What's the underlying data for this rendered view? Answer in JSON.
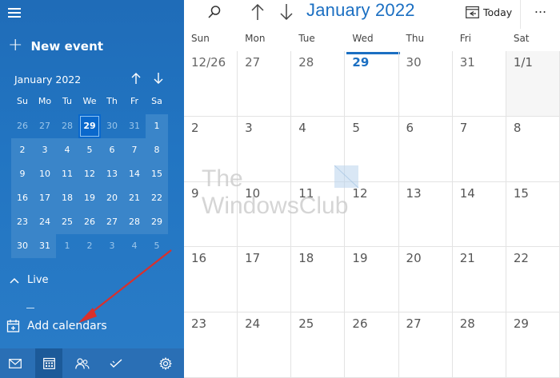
{
  "sidebar": {
    "new_event_label": "New event",
    "mini_calendar": {
      "title": "January 2022",
      "weekdays": [
        "Su",
        "Mo",
        "Tu",
        "We",
        "Th",
        "Fr",
        "Sa"
      ],
      "days": [
        {
          "d": "26",
          "other": true
        },
        {
          "d": "27",
          "other": true
        },
        {
          "d": "28",
          "other": true
        },
        {
          "d": "29",
          "other": true,
          "today": true
        },
        {
          "d": "30",
          "other": true
        },
        {
          "d": "31",
          "other": true
        },
        {
          "d": "1"
        },
        {
          "d": "2"
        },
        {
          "d": "3"
        },
        {
          "d": "4"
        },
        {
          "d": "5"
        },
        {
          "d": "6"
        },
        {
          "d": "7"
        },
        {
          "d": "8"
        },
        {
          "d": "9"
        },
        {
          "d": "10"
        },
        {
          "d": "11"
        },
        {
          "d": "12"
        },
        {
          "d": "13"
        },
        {
          "d": "14"
        },
        {
          "d": "15"
        },
        {
          "d": "16"
        },
        {
          "d": "17"
        },
        {
          "d": "18"
        },
        {
          "d": "19"
        },
        {
          "d": "20"
        },
        {
          "d": "21"
        },
        {
          "d": "22"
        },
        {
          "d": "23"
        },
        {
          "d": "24"
        },
        {
          "d": "25"
        },
        {
          "d": "26"
        },
        {
          "d": "27"
        },
        {
          "d": "28"
        },
        {
          "d": "29"
        },
        {
          "d": "30"
        },
        {
          "d": "31"
        },
        {
          "d": "1",
          "other": true
        },
        {
          "d": "2",
          "other": true
        },
        {
          "d": "3",
          "other": true
        },
        {
          "d": "4",
          "other": true
        },
        {
          "d": "5",
          "other": true
        }
      ]
    },
    "live_label": "Live",
    "add_calendars_label": "Add calendars",
    "bottom_icons": [
      "mail-icon",
      "calendar-icon",
      "people-icon",
      "todo-icon",
      "settings-icon"
    ]
  },
  "toolbar": {
    "month_title": "January 2022",
    "today_label": "Today",
    "more_label": "..."
  },
  "calendar": {
    "weekdays": [
      "Sun",
      "Mon",
      "Tue",
      "Wed",
      "Thu",
      "Fri",
      "Sat"
    ],
    "weeks": [
      [
        {
          "d": "12/26",
          "other": true
        },
        {
          "d": "27",
          "other": true
        },
        {
          "d": "28",
          "other": true
        },
        {
          "d": "29",
          "other": true,
          "today": true
        },
        {
          "d": "30",
          "other": true
        },
        {
          "d": "31",
          "other": true
        },
        {
          "d": "1/1"
        }
      ],
      [
        {
          "d": "2"
        },
        {
          "d": "3"
        },
        {
          "d": "4"
        },
        {
          "d": "5"
        },
        {
          "d": "6"
        },
        {
          "d": "7"
        },
        {
          "d": "8"
        }
      ],
      [
        {
          "d": "9"
        },
        {
          "d": "10"
        },
        {
          "d": "11"
        },
        {
          "d": "12"
        },
        {
          "d": "13"
        },
        {
          "d": "14"
        },
        {
          "d": "15"
        }
      ],
      [
        {
          "d": "16"
        },
        {
          "d": "17"
        },
        {
          "d": "18"
        },
        {
          "d": "19"
        },
        {
          "d": "20"
        },
        {
          "d": "21"
        },
        {
          "d": "22"
        }
      ],
      [
        {
          "d": "23"
        },
        {
          "d": "24"
        },
        {
          "d": "25"
        },
        {
          "d": "26"
        },
        {
          "d": "27"
        },
        {
          "d": "28"
        },
        {
          "d": "29"
        }
      ]
    ]
  },
  "watermark": {
    "line1": "The",
    "line2": "WindowsClub"
  },
  "colors": {
    "accent": "#1b6fc2",
    "sidebar": "#2275c2",
    "annotation_arrow": "#d9302c"
  }
}
